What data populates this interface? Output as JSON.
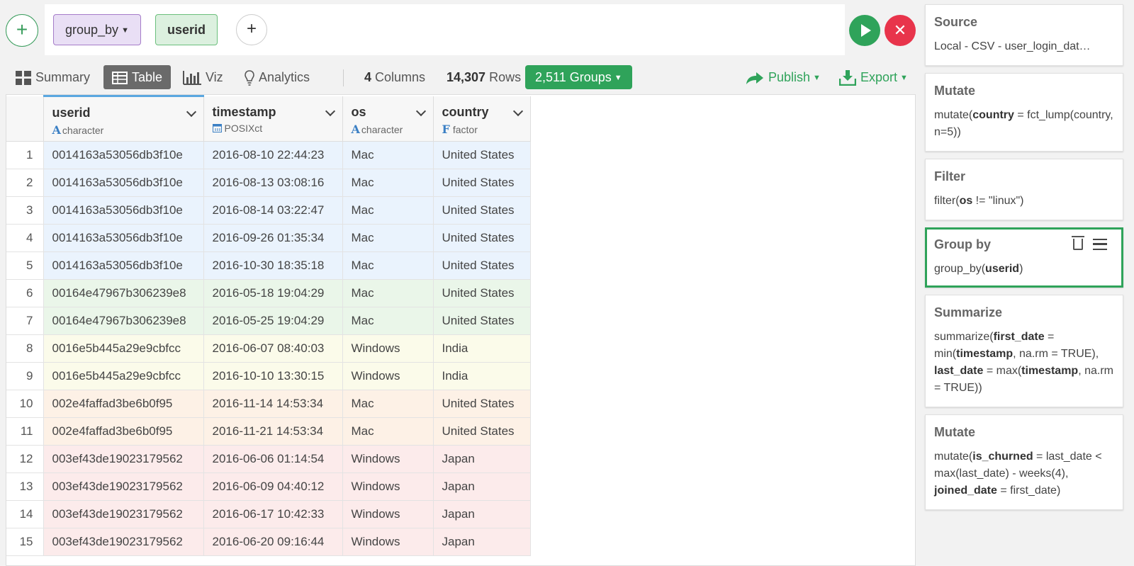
{
  "command": {
    "add_label": "+",
    "verb": "group_by",
    "argument": "userid",
    "add_arg_label": "+"
  },
  "toolbar": {
    "summary": "Summary",
    "table": "Table",
    "viz": "Viz",
    "analytics": "Analytics",
    "columns_count": "4",
    "columns_label": "Columns",
    "rows_count": "14,307",
    "rows_label": "Rows",
    "groups": "2,511 Groups",
    "publish": "Publish",
    "export": "Export"
  },
  "columns": [
    {
      "name": "userid",
      "type": "character",
      "type_icon": "A"
    },
    {
      "name": "timestamp",
      "type": "POSIXct",
      "type_icon": "calendar"
    },
    {
      "name": "os",
      "type": "character",
      "type_icon": "A"
    },
    {
      "name": "country",
      "type": "factor",
      "type_icon": "F"
    }
  ],
  "rows": [
    {
      "idx": "1",
      "userid": "0014163a53056db3f10e",
      "timestamp": "2016-08-10 22:44:23",
      "os": "Mac",
      "country": "United States",
      "group": 0
    },
    {
      "idx": "2",
      "userid": "0014163a53056db3f10e",
      "timestamp": "2016-08-13 03:08:16",
      "os": "Mac",
      "country": "United States",
      "group": 0
    },
    {
      "idx": "3",
      "userid": "0014163a53056db3f10e",
      "timestamp": "2016-08-14 03:22:47",
      "os": "Mac",
      "country": "United States",
      "group": 0
    },
    {
      "idx": "4",
      "userid": "0014163a53056db3f10e",
      "timestamp": "2016-09-26 01:35:34",
      "os": "Mac",
      "country": "United States",
      "group": 0
    },
    {
      "idx": "5",
      "userid": "0014163a53056db3f10e",
      "timestamp": "2016-10-30 18:35:18",
      "os": "Mac",
      "country": "United States",
      "group": 0
    },
    {
      "idx": "6",
      "userid": "00164e47967b306239e8",
      "timestamp": "2016-05-18 19:04:29",
      "os": "Mac",
      "country": "United States",
      "group": 1
    },
    {
      "idx": "7",
      "userid": "00164e47967b306239e8",
      "timestamp": "2016-05-25 19:04:29",
      "os": "Mac",
      "country": "United States",
      "group": 1
    },
    {
      "idx": "8",
      "userid": "0016e5b445a29e9cbfcc",
      "timestamp": "2016-06-07 08:40:03",
      "os": "Windows",
      "country": "India",
      "group": 2
    },
    {
      "idx": "9",
      "userid": "0016e5b445a29e9cbfcc",
      "timestamp": "2016-10-10 13:30:15",
      "os": "Windows",
      "country": "India",
      "group": 2
    },
    {
      "idx": "10",
      "userid": "002e4faffad3be6b0f95",
      "timestamp": "2016-11-14 14:53:34",
      "os": "Mac",
      "country": "United States",
      "group": 3
    },
    {
      "idx": "11",
      "userid": "002e4faffad3be6b0f95",
      "timestamp": "2016-11-21 14:53:34",
      "os": "Mac",
      "country": "United States",
      "group": 3
    },
    {
      "idx": "12",
      "userid": "003ef43de19023179562",
      "timestamp": "2016-06-06 01:14:54",
      "os": "Windows",
      "country": "Japan",
      "group": 4
    },
    {
      "idx": "13",
      "userid": "003ef43de19023179562",
      "timestamp": "2016-06-09 04:40:12",
      "os": "Windows",
      "country": "Japan",
      "group": 4
    },
    {
      "idx": "14",
      "userid": "003ef43de19023179562",
      "timestamp": "2016-06-17 10:42:33",
      "os": "Windows",
      "country": "Japan",
      "group": 4
    },
    {
      "idx": "15",
      "userid": "003ef43de19023179562",
      "timestamp": "2016-06-20 09:16:44",
      "os": "Windows",
      "country": "Japan",
      "group": 4
    }
  ],
  "steps": {
    "source": {
      "title": "Source",
      "body": "Local - CSV - user_login_dat…"
    },
    "mutate1": {
      "title": "Mutate",
      "fn": "mutate(",
      "arg": "country",
      "rest": " = fct_lump(country, n=5))"
    },
    "filter": {
      "title": "Filter",
      "fn": "filter(",
      "arg": "os",
      "rest": " != \"linux\")"
    },
    "groupby": {
      "title": "Group by",
      "fn": "group_by(",
      "arg": "userid",
      "rest": ")"
    },
    "summarize": {
      "title": "Summarize",
      "p1": "summarize(",
      "a1": "first_date",
      "p2": " = min(",
      "a2": "timestamp",
      "p3": ", na.rm = TRUE), ",
      "a3": "last_date",
      "p4": " = max(",
      "a4": "timestamp",
      "p5": ", na.rm = TRUE))"
    },
    "mutate2": {
      "title": "Mutate",
      "p1": "mutate(",
      "a1": "is_churned",
      "p2": " = last_date < max(last_date) - weeks(4), ",
      "a2": "joined_date",
      "p3": " = first_date)"
    }
  },
  "colors": {
    "accent_green": "#2fa35a",
    "cancel_red": "#e8344b",
    "verb_purple": "#e9dff5",
    "arg_green": "#dcf0df"
  }
}
